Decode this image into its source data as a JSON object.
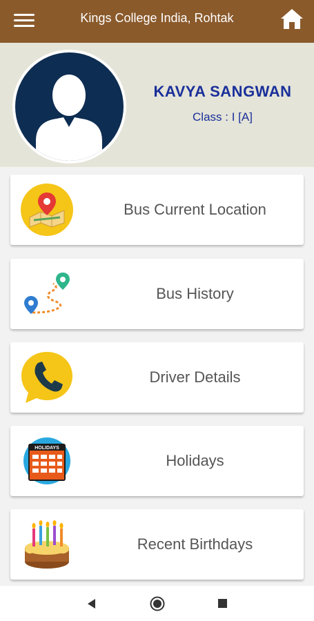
{
  "header": {
    "title": "Kings College India, Rohtak",
    "menu_icon": "hamburger-menu-icon",
    "home_icon": "home-icon"
  },
  "profile": {
    "name": "KAVYA SANGWAN",
    "class_text": "Class : I [A]",
    "avatar_icon": "person-silhouette-icon"
  },
  "menu": {
    "items": [
      {
        "label": "Bus Current Location",
        "icon": "map-pin-icon"
      },
      {
        "label": "Bus History",
        "icon": "route-icon"
      },
      {
        "label": "Driver Details",
        "icon": "phone-chat-icon"
      },
      {
        "label": "Holidays",
        "icon": "holidays-calendar-icon",
        "icon_text": "HOLIDAYS"
      },
      {
        "label": "Recent Birthdays",
        "icon": "birthday-cake-icon"
      }
    ]
  },
  "system_nav": {
    "back_icon": "back-triangle-icon",
    "home_icon": "home-circle-icon",
    "recent_icon": "recents-square-icon"
  },
  "colors": {
    "app_bar": "#8b5a2b",
    "profile_bg": "#e4e4d8",
    "name_color": "#1a2f9a",
    "avatar_bg": "#0e2d52",
    "icon_yellow": "#f5c518"
  }
}
